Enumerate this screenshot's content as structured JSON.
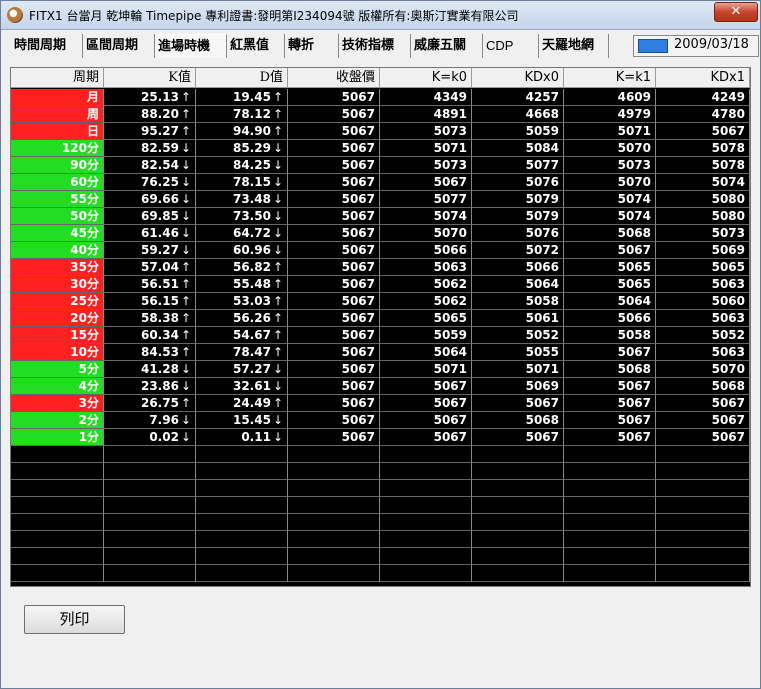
{
  "window": {
    "title": "FITX1 台當月    乾坤輪 Timepipe 專利證書:發明第I234094號 版權所有:奧斯汀實業有限公司",
    "close_label": "✕"
  },
  "tabs": [
    {
      "label": "時間周期"
    },
    {
      "label": "區間周期"
    },
    {
      "label": "進場時機"
    },
    {
      "label": "紅黑值"
    },
    {
      "label": "轉折"
    },
    {
      "label": "技術指標"
    },
    {
      "label": "威廉五關"
    },
    {
      "label": "CDP"
    },
    {
      "label": "天羅地網"
    }
  ],
  "active_tab": "進場時機",
  "date": "2009/03/18",
  "table": {
    "columns": [
      "周期",
      "K值",
      "D值",
      "收盤價",
      "K=k0",
      "KDx0",
      "K=k1",
      "KDx1"
    ],
    "rows": [
      {
        "period": "月",
        "color": "red",
        "k": "25.13",
        "k_arrow": "↑",
        "d": "19.45",
        "d_arrow": "↑",
        "close": "5067",
        "k0": "4349",
        "kdx0": "4257",
        "k1": "4609",
        "kdx1": "4249"
      },
      {
        "period": "周",
        "color": "red",
        "k": "88.20",
        "k_arrow": "↑",
        "d": "78.12",
        "d_arrow": "↑",
        "close": "5067",
        "k0": "4891",
        "kdx0": "4668",
        "k1": "4979",
        "kdx1": "4780"
      },
      {
        "period": "日",
        "color": "red",
        "k": "95.27",
        "k_arrow": "↑",
        "d": "94.90",
        "d_arrow": "↑",
        "close": "5067",
        "k0": "5073",
        "kdx0": "5059",
        "k1": "5071",
        "kdx1": "5067"
      },
      {
        "period": "120分",
        "color": "green",
        "k": "82.59",
        "k_arrow": "↓",
        "d": "85.29",
        "d_arrow": "↓",
        "close": "5067",
        "k0": "5071",
        "kdx0": "5084",
        "k1": "5070",
        "kdx1": "5078"
      },
      {
        "period": "90分",
        "color": "green",
        "k": "82.54",
        "k_arrow": "↓",
        "d": "84.25",
        "d_arrow": "↓",
        "close": "5067",
        "k0": "5073",
        "kdx0": "5077",
        "k1": "5073",
        "kdx1": "5078"
      },
      {
        "period": "60分",
        "color": "green",
        "k": "76.25",
        "k_arrow": "↓",
        "d": "78.15",
        "d_arrow": "↓",
        "close": "5067",
        "k0": "5067",
        "kdx0": "5076",
        "k1": "5070",
        "kdx1": "5074"
      },
      {
        "period": "55分",
        "color": "green",
        "k": "69.66",
        "k_arrow": "↓",
        "d": "73.48",
        "d_arrow": "↓",
        "close": "5067",
        "k0": "5077",
        "kdx0": "5079",
        "k1": "5074",
        "kdx1": "5080"
      },
      {
        "period": "50分",
        "color": "green",
        "k": "69.85",
        "k_arrow": "↓",
        "d": "73.50",
        "d_arrow": "↓",
        "close": "5067",
        "k0": "5074",
        "kdx0": "5079",
        "k1": "5074",
        "kdx1": "5080"
      },
      {
        "period": "45分",
        "color": "green",
        "k": "61.46",
        "k_arrow": "↓",
        "d": "64.72",
        "d_arrow": "↓",
        "close": "5067",
        "k0": "5070",
        "kdx0": "5076",
        "k1": "5068",
        "kdx1": "5073"
      },
      {
        "period": "40分",
        "color": "green",
        "k": "59.27",
        "k_arrow": "↓",
        "d": "60.96",
        "d_arrow": "↓",
        "close": "5067",
        "k0": "5066",
        "kdx0": "5072",
        "k1": "5067",
        "kdx1": "5069"
      },
      {
        "period": "35分",
        "color": "red",
        "k": "57.04",
        "k_arrow": "↑",
        "d": "56.82",
        "d_arrow": "↑",
        "close": "5067",
        "k0": "5063",
        "kdx0": "5066",
        "k1": "5065",
        "kdx1": "5065"
      },
      {
        "period": "30分",
        "color": "red",
        "k": "56.51",
        "k_arrow": "↑",
        "d": "55.48",
        "d_arrow": "↑",
        "close": "5067",
        "k0": "5062",
        "kdx0": "5064",
        "k1": "5065",
        "kdx1": "5063"
      },
      {
        "period": "25分",
        "color": "red",
        "k": "56.15",
        "k_arrow": "↑",
        "d": "53.03",
        "d_arrow": "↑",
        "close": "5067",
        "k0": "5062",
        "kdx0": "5058",
        "k1": "5064",
        "kdx1": "5060"
      },
      {
        "period": "20分",
        "color": "red",
        "k": "58.38",
        "k_arrow": "↑",
        "d": "56.26",
        "d_arrow": "↑",
        "close": "5067",
        "k0": "5065",
        "kdx0": "5061",
        "k1": "5066",
        "kdx1": "5063"
      },
      {
        "period": "15分",
        "color": "red",
        "k": "60.34",
        "k_arrow": "↑",
        "d": "54.67",
        "d_arrow": "↑",
        "close": "5067",
        "k0": "5059",
        "kdx0": "5052",
        "k1": "5058",
        "kdx1": "5052"
      },
      {
        "period": "10分",
        "color": "red",
        "k": "84.53",
        "k_arrow": "↑",
        "d": "78.47",
        "d_arrow": "↑",
        "close": "5067",
        "k0": "5064",
        "kdx0": "5055",
        "k1": "5067",
        "kdx1": "5063"
      },
      {
        "period": "5分",
        "color": "green",
        "k": "41.28",
        "k_arrow": "↓",
        "d": "57.27",
        "d_arrow": "↓",
        "close": "5067",
        "k0": "5071",
        "kdx0": "5071",
        "k1": "5068",
        "kdx1": "5070"
      },
      {
        "period": "4分",
        "color": "green",
        "k": "23.86",
        "k_arrow": "↓",
        "d": "32.61",
        "d_arrow": "↓",
        "close": "5067",
        "k0": "5067",
        "kdx0": "5069",
        "k1": "5067",
        "kdx1": "5068"
      },
      {
        "period": "3分",
        "color": "red",
        "k": "26.75",
        "k_arrow": "↑",
        "d": "24.49",
        "d_arrow": "↑",
        "close": "5067",
        "k0": "5067",
        "kdx0": "5067",
        "k1": "5067",
        "kdx1": "5067"
      },
      {
        "period": "2分",
        "color": "green",
        "k": "7.96",
        "k_arrow": "↓",
        "d": "15.45",
        "d_arrow": "↓",
        "close": "5067",
        "k0": "5067",
        "kdx0": "5068",
        "k1": "5067",
        "kdx1": "5067"
      },
      {
        "period": "1分",
        "color": "green",
        "k": "0.02",
        "k_arrow": "↓",
        "d": "0.11",
        "d_arrow": "↓",
        "close": "5067",
        "k0": "5067",
        "kdx0": "5067",
        "k1": "5067",
        "kdx1": "5067"
      }
    ]
  },
  "print_button": "列印",
  "colors": {
    "up_row": "#ff2020",
    "down_row": "#22dd22",
    "date_indicator": "#2f7fe0"
  }
}
